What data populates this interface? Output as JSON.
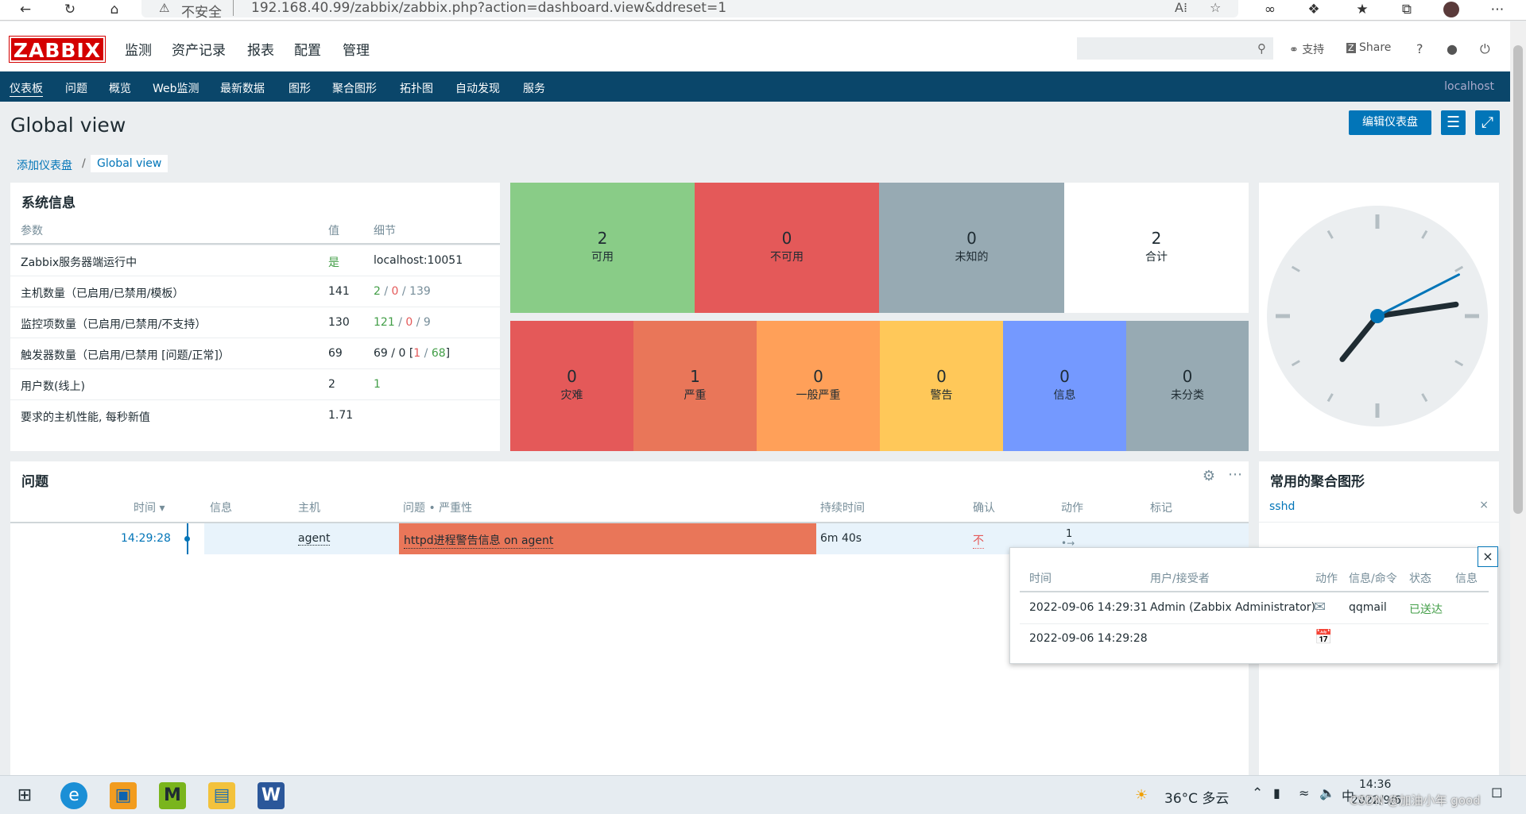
{
  "browser": {
    "not_secure": "不安全",
    "url": "192.168.40.99/zabbix/zabbix.php?action=dashboard.view&ddreset=1",
    "icons": [
      "back-icon",
      "reload-icon",
      "home-icon",
      "warning-icon",
      "read-aloud-icon",
      "favorite-icon",
      "infinity-icon",
      "extensions-icon",
      "favorites-list-icon",
      "collections-icon",
      "profile-avatar",
      "more-icon"
    ]
  },
  "header": {
    "logo": "ZABBIX",
    "menu": [
      "监测",
      "资产记录",
      "报表",
      "配置",
      "管理"
    ],
    "support": "支持",
    "share": "Share",
    "help": "?"
  },
  "nav": {
    "items": [
      "仪表板",
      "问题",
      "概览",
      "Web监测",
      "最新数据",
      "图形",
      "聚合图形",
      "拓扑图",
      "自动发现",
      "服务"
    ],
    "host": "localhost"
  },
  "page": {
    "title": "Global view",
    "edit_button": "编辑仪表盘",
    "breadcrumb": [
      "添加仪表盘",
      "Global view"
    ]
  },
  "sysinfo": {
    "title": "系统信息",
    "headers": [
      "参数",
      "值",
      "细节"
    ],
    "rows": [
      {
        "param": "Zabbix服务器端运行中",
        "value": "是",
        "detail": "localhost:10051"
      },
      {
        "param": "主机数量（已启用/已禁用/模板）",
        "value": "141",
        "d1": "2",
        "d2": "0",
        "d3": "139"
      },
      {
        "param": "监控项数量（已启用/已禁用/不支持）",
        "value": "130",
        "d1": "121",
        "d2": "0",
        "d3": "9"
      },
      {
        "param": "触发器数量（已启用/已禁用 [问题/正常]）",
        "value": "69",
        "d1": "69",
        "d2": "0",
        "d3": "1",
        "d4": "68"
      },
      {
        "param": "用户数(线上)",
        "value": "2",
        "d1": "1"
      },
      {
        "param": "要求的主机性能, 每秒新值",
        "value": "1.71"
      }
    ]
  },
  "hosts": [
    {
      "n": "2",
      "t": "可用",
      "color": "#89cc87"
    },
    {
      "n": "0",
      "t": "不可用",
      "color": "#e45959"
    },
    {
      "n": "0",
      "t": "未知的",
      "color": "#97aab3"
    },
    {
      "n": "2",
      "t": "合计",
      "color": "#ffffff"
    }
  ],
  "severity": [
    {
      "n": "0",
      "t": "灾难",
      "color": "#e45959"
    },
    {
      "n": "1",
      "t": "严重",
      "color": "#e97659"
    },
    {
      "n": "0",
      "t": "一般严重",
      "color": "#ffa059"
    },
    {
      "n": "0",
      "t": "警告",
      "color": "#ffc859"
    },
    {
      "n": "0",
      "t": "信息",
      "color": "#7499ff"
    },
    {
      "n": "0",
      "t": "未分类",
      "color": "#97aab3"
    }
  ],
  "clock": {
    "hour": 7.3,
    "minute": 13.6,
    "second": 10.5
  },
  "problems": {
    "title": "问题",
    "headers": [
      "时间 ▾",
      "信息",
      "主机",
      "问题 • 严重性",
      "持续时间",
      "确认",
      "动作",
      "标记"
    ],
    "rows": [
      {
        "time": "14:29:28",
        "host": "agent",
        "problem": "httpd进程警告信息 on agent",
        "duration": "6m 40s",
        "ack": "不",
        "actions": "1"
      }
    ]
  },
  "graphs": {
    "title": "常用的聚合图形",
    "items": [
      "sshd"
    ],
    "remove": "×"
  },
  "popup": {
    "close": "×",
    "headers": [
      "时间",
      "用户/接受者",
      "动作",
      "信息/命令",
      "状态",
      "信息"
    ],
    "rows": [
      {
        "time": "2022-09-06 14:29:31",
        "user": "Admin (Zabbix Administrator)",
        "icon": "envelope-icon",
        "cmd": "qqmail",
        "status": "已送达"
      },
      {
        "time": "2022-09-06 14:29:28",
        "user": "",
        "icon": "calendar-icon",
        "cmd": "",
        "status": ""
      }
    ]
  },
  "taskbar": {
    "weather": "36°C 多云",
    "time": "14:36",
    "date": "2022/9/6",
    "watermark": "CSDN @加油小年 good"
  },
  "colors": {
    "nav": "#0a466a",
    "button": "#0275b8",
    "logo": "#d40000"
  }
}
